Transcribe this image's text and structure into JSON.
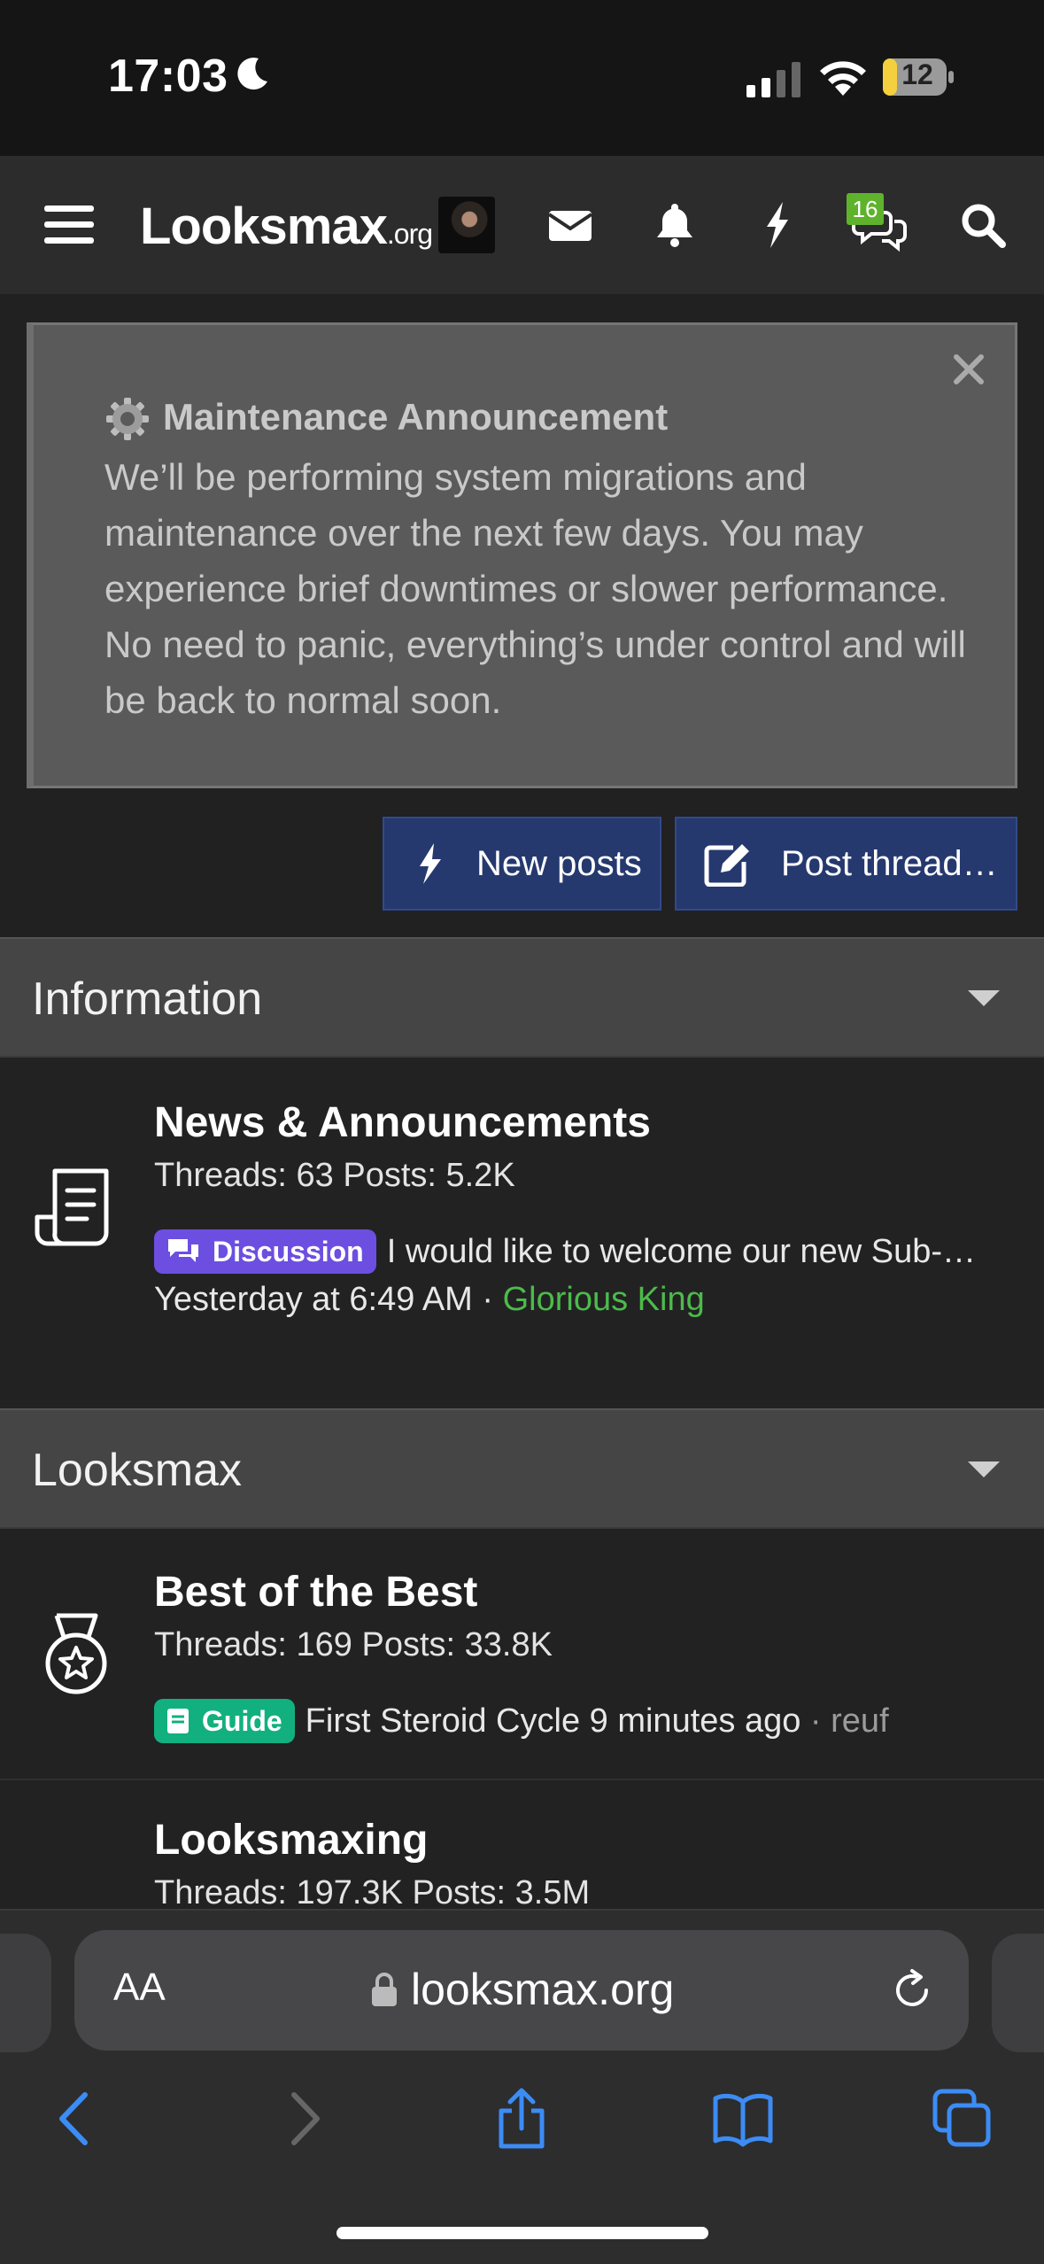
{
  "status_bar": {
    "time": "17:03",
    "battery": "12"
  },
  "header": {
    "logo_main": "Looksmax",
    "logo_suffix": ".org",
    "chat_badge": "16",
    "icons": [
      "menu-icon",
      "avatar",
      "mail-icon",
      "bell-icon",
      "bolt-icon",
      "chat-icon",
      "search-icon"
    ]
  },
  "notice": {
    "title": "Maintenance Announcement",
    "body": "We’ll be performing system migrations and maintenance over the next few days. You may experience brief downtimes or slower performance. No need to panic, everything’s under control and will be back to normal soon."
  },
  "actions": {
    "new_posts": "New posts",
    "post_thread": "Post thread…"
  },
  "categories": [
    {
      "title": "Information",
      "nodes": [
        {
          "title": "News & Announcements",
          "stats": "Threads: 63 Posts: 5.2K",
          "label": "Discussion",
          "latest_title": "I would like to welcome our new Sub-…",
          "latest_time": "Yesterday at 6:49 AM",
          "latest_user": "Glorious King",
          "icon": "document-icon"
        }
      ]
    },
    {
      "title": "Looksmax",
      "nodes": [
        {
          "title": "Best of the Best",
          "stats": "Threads: 169 Posts: 33.8K",
          "label": "Guide",
          "latest_title": "First Steroid Cycle",
          "latest_time": "9 minutes ago",
          "latest_user": "reuf",
          "icon": "medal-icon"
        },
        {
          "title": "Looksmaxing",
          "stats": "Threads: 197.3K Posts: 3.5M"
        }
      ]
    }
  ],
  "browser": {
    "url": "looksmax.org",
    "text_size": "AA"
  },
  "colors": {
    "accent_button": "#25396f",
    "discussion_label": "#6c4fe0",
    "guide_label": "#13b07f",
    "username_green": "#4cbb4b",
    "badge_green": "#5fb32c"
  }
}
